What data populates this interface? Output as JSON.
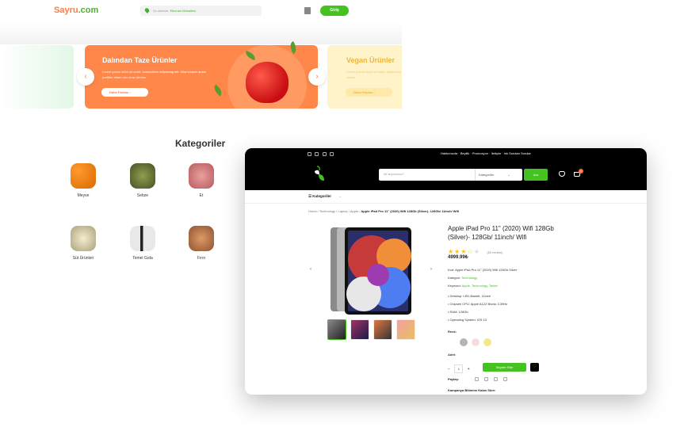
{
  "header": {
    "logo_a": "Sayru",
    "logo_b": ".com",
    "location_prefix": "Şu adreste:",
    "location_value": "Ekinnan Mahallesi",
    "login_label": "Giriş"
  },
  "banners": [
    {
      "title": "Dalından Taze Ürünler",
      "text": "Lorem ipsum dolor sit amet, consectetur adipiscing elit. Ullamcorper quam porttitor etiam nec urna ultrices.",
      "button": "Daha Fazlası"
    },
    {
      "title": "Vegan Ürünler",
      "text": "Lorem ipsum dolor sit amet, adipiscing elit. At varius",
      "button": "Daha Fazlası"
    }
  ],
  "categories": {
    "title": "Kategoriler",
    "items": [
      "Meyve",
      "Sebze",
      "Et",
      "Süt Ürünleri",
      "Temel Gıda",
      "Fırın"
    ]
  },
  "window": {
    "nav": [
      "Hakkımızda",
      "Beyilik",
      "Promosyon",
      "İletişim",
      "İnk Sorulan Sorular"
    ],
    "search_placeholder": "Ne arıyorsunuz?",
    "search_category": "Kategoriler",
    "search_button": "Ara",
    "cart_count": "0",
    "category_menu": "Kategoriler",
    "breadcrumb": "Home / Technology / Laptop / Apple / ",
    "breadcrumb_current": "Apple iPad Pro 11\" (2020) Wifi 128Gb (Silver)- 128Gb/ 11inch/ Wifi",
    "product_title": "Apple iPad Pro 11\" (2020) Wifi 128Gb (Silver)- 128Gb/ 11inch/ Wifi",
    "rating": 3.5,
    "reviews": "(60 review)",
    "price": "4999.99₺",
    "code": "Kod: Apple iPad Pro 11\" (2020) Wifi 128Gb Silver",
    "category_label": "Kategori:",
    "category_value": "Technology",
    "keyword_label": "Keyword:",
    "keyword_value": "Apple, Technology, Tablet",
    "specs": [
      "• Desktop: LED-Backlit, 11inch",
      "• Chipset/ CPU: Apple A12Z Bionic 3.39Hz",
      "• RAM: 128Gb",
      "• Operating System: iOS 13"
    ],
    "color_label": "Renk:",
    "colors": [
      "#b5b5b5",
      "#f6dede",
      "#f4e98a"
    ],
    "qty_label": "Adet:",
    "qty_value": "1",
    "add_to_cart": "Sepete Ekle",
    "share_label": "Paylaş:",
    "campaign_label": "Kampanya Bitimine Kalan Süre:"
  }
}
